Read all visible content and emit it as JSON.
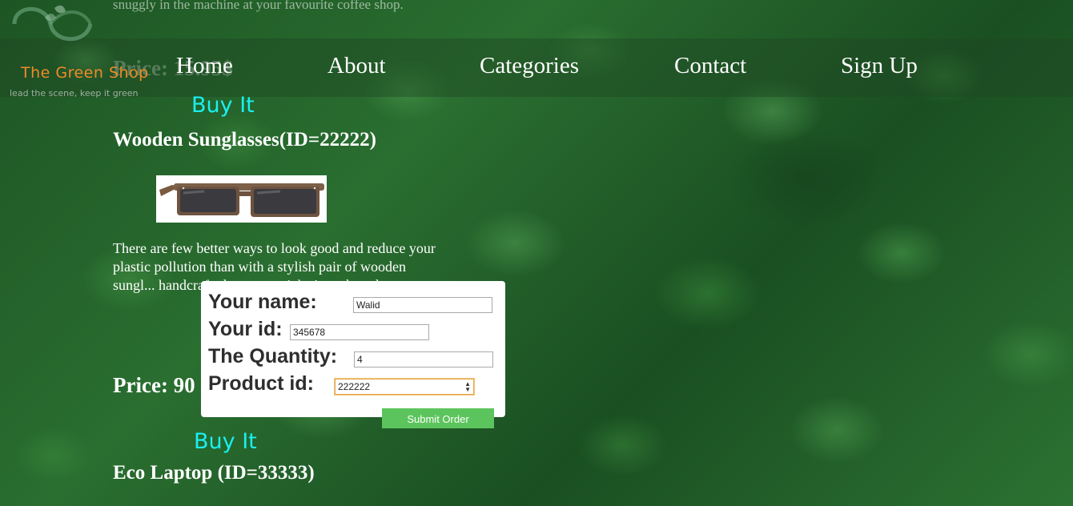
{
  "background": {
    "partial_text": "snuggly in the machine at your favourite coffee shop.",
    "partial_price": "Price: 15.95$"
  },
  "logo": {
    "name": "The Green Shop",
    "tagline": "lead the scene, keep it green"
  },
  "nav": {
    "items": [
      "Home",
      "About",
      "Categories",
      "Contact",
      "Sign Up"
    ]
  },
  "products": [
    {
      "buy_label": "Buy It",
      "title": "Wooden Sunglasses(ID=22222)",
      "image_alt": "wooden sunglasses",
      "description": "There are few better ways to look good and reduce your plastic pollution than with a stylish pair of wooden sungl... handcrafted w... materials, inc... based acetate,...",
      "price": "Price: 90"
    },
    {
      "buy_label": "Buy It",
      "title": "Eco Laptop (ID=33333)"
    }
  ],
  "order_form": {
    "name_label": "Your name:",
    "name_value": "Walid",
    "id_label": "Your id:",
    "id_value": "345678",
    "quantity_label": "The Quantity:",
    "quantity_value": "4",
    "product_label": "Product id:",
    "product_value": "222222",
    "submit_label": "Submit Order"
  },
  "colors": {
    "buy_it": "#19f0f0",
    "submit": "#5cc45c",
    "logo_text": "#f08a2a"
  }
}
